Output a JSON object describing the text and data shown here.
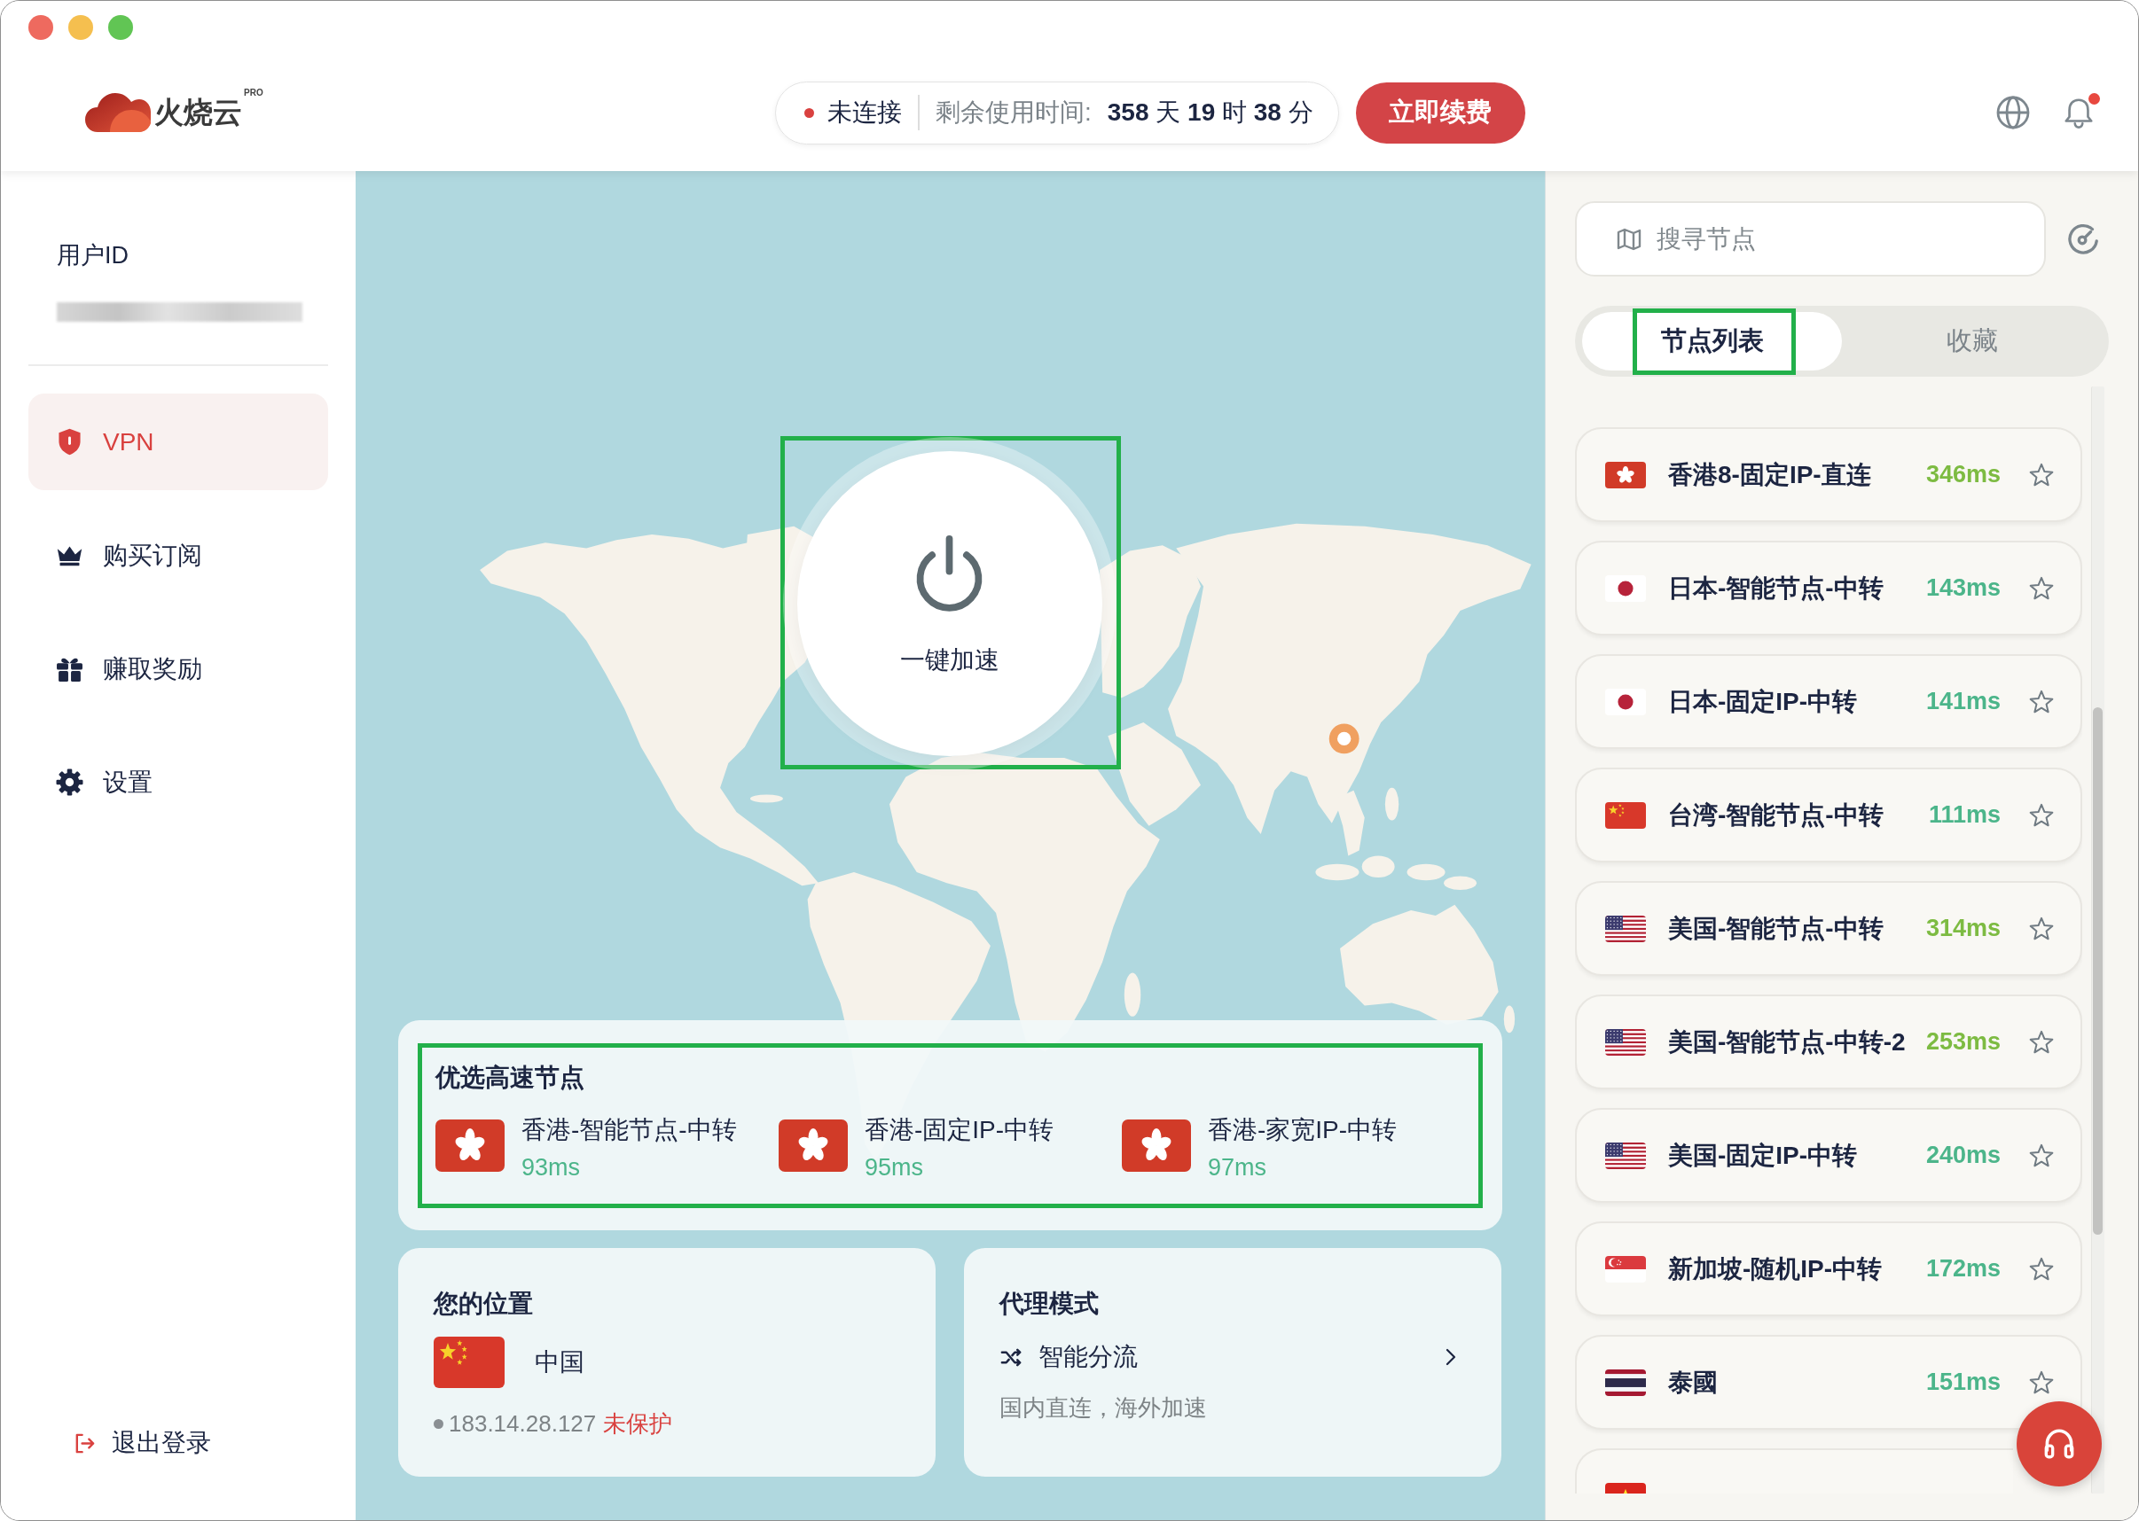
{
  "header": {
    "logo": {
      "name": "火烧云",
      "badge": "PRO"
    },
    "status": {
      "connected": false,
      "label": "未连接",
      "remaining_label": "剩余使用时间:",
      "remaining": "**358** 天 **19** 时 **38** 分"
    },
    "renew_button": "立即续费",
    "notifications": {
      "unread": true
    }
  },
  "sidebar": {
    "user_label": "用户ID",
    "items": [
      {
        "kind": "shield",
        "label": "VPN",
        "selected": true
      },
      {
        "kind": "crown",
        "label": "购买订阅",
        "selected": false
      },
      {
        "kind": "gift",
        "label": "赚取奖励",
        "selected": false
      },
      {
        "kind": "gear",
        "label": "设置",
        "selected": false
      }
    ],
    "logout": "退出登录"
  },
  "map": {
    "power_button": {
      "label": "一键加速",
      "highlighted": true
    },
    "featured": {
      "title": "优选高速节点",
      "highlighted": true,
      "nodes": [
        {
          "flag": {
            "kind": "hk"
          },
          "name": "香港-智能节点-中转",
          "latency": "93ms"
        },
        {
          "flag": {
            "kind": "hk"
          },
          "name": "香港-固定IP-中转",
          "latency": "95ms"
        },
        {
          "flag": {
            "kind": "hk"
          },
          "name": "香港-家宽IP-中转",
          "latency": "97ms"
        }
      ]
    },
    "location": {
      "title": "您的位置",
      "flag": {
        "kind": "cn"
      },
      "country": "中国",
      "ip": "183.14.28.127",
      "protected": false,
      "status": "未保护"
    },
    "proxy_mode": {
      "title": "代理模式",
      "mode": "智能分流",
      "description": "国内直连，海外加速"
    }
  },
  "node_panel": {
    "search": {
      "placeholder": "搜寻节点"
    },
    "tabs": [
      {
        "label": "节点列表",
        "selected": true,
        "highlighted": true
      },
      {
        "label": "收藏",
        "selected": false,
        "highlighted": false
      }
    ],
    "nodes": [
      {
        "flag": {
          "kind": "hk"
        },
        "name": "香港8-固定IP-直连",
        "latency": "346ms",
        "color": "#7dbb42",
        "favorite": false
      },
      {
        "flag": {
          "kind": "jp"
        },
        "name": "日本-智能节点-中转",
        "latency": "143ms",
        "color": "#4cb58a",
        "favorite": false
      },
      {
        "flag": {
          "kind": "jp"
        },
        "name": "日本-固定IP-中转",
        "latency": "141ms",
        "color": "#4cb58a",
        "favorite": false
      },
      {
        "flag": {
          "kind": "cn"
        },
        "name": "台湾-智能节点-中转",
        "latency": "111ms",
        "color": "#4cb58a",
        "favorite": false
      },
      {
        "flag": {
          "kind": "us"
        },
        "name": "美国-智能节点-中转",
        "latency": "314ms",
        "color": "#7dbb42",
        "favorite": false
      },
      {
        "flag": {
          "kind": "us"
        },
        "name": "美国-智能节点-中转-2",
        "latency": "253ms",
        "color": "#7dbb42",
        "favorite": false
      },
      {
        "flag": {
          "kind": "us"
        },
        "name": "美国-固定IP-中转",
        "latency": "240ms",
        "color": "#4cb58a",
        "favorite": false
      },
      {
        "flag": {
          "kind": "sg"
        },
        "name": "新加坡-随机IP-中转",
        "latency": "172ms",
        "color": "#4cb58a",
        "favorite": false
      },
      {
        "flag": {
          "kind": "th"
        },
        "name": "泰國",
        "latency": "151ms",
        "color": "#4cb58a",
        "favorite": false
      },
      {
        "flag": {
          "kind": "vn"
        }
      }
    ]
  }
}
